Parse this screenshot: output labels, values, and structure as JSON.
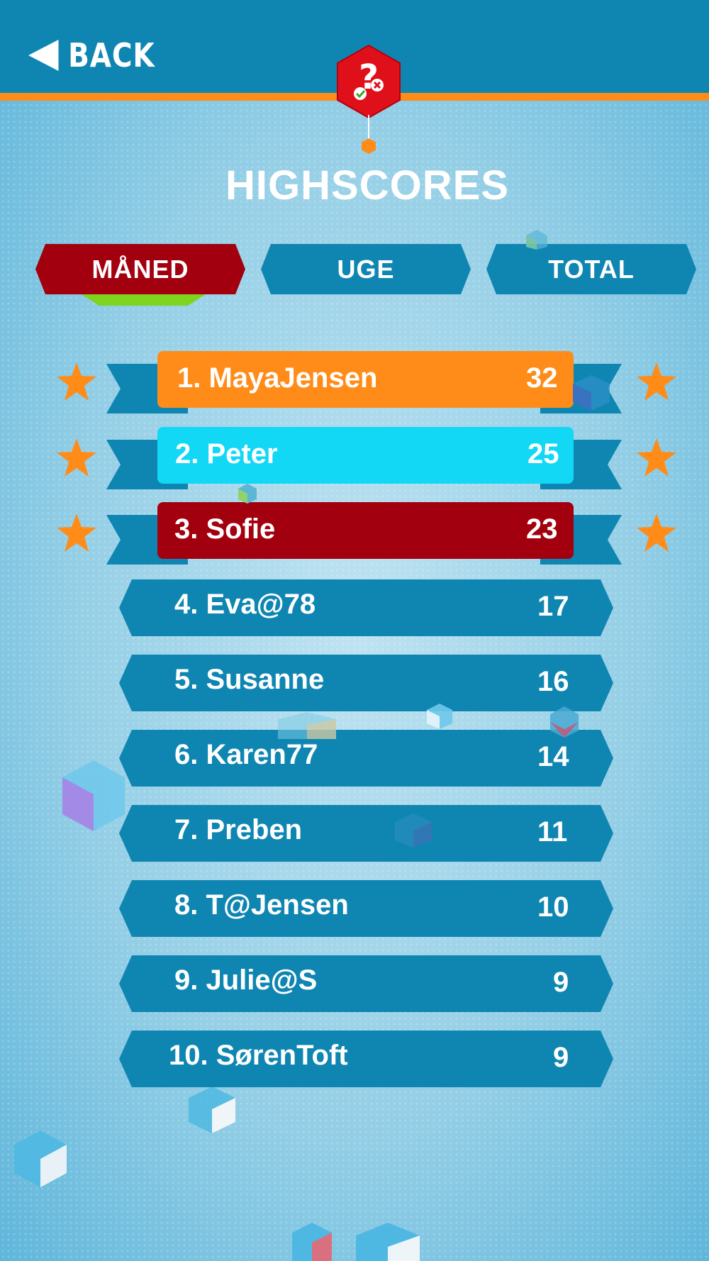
{
  "header": {
    "back_label": "BACK"
  },
  "page_title": "HIGHSCORES",
  "tabs": [
    {
      "label": "MÅNED",
      "active": true
    },
    {
      "label": "UGE",
      "active": false
    },
    {
      "label": "TOTAL",
      "active": false
    }
  ],
  "colors": {
    "header": "#0f86b2",
    "accent_stripe": "#ff8c19",
    "tab_active": "#a3000f",
    "tab_inactive": "#0f86b2",
    "tab_indicator": "#7fd420",
    "rank1": "#ff8c19",
    "rank2": "#12d8f5",
    "rank3": "#a3000f",
    "row_default": "#0f86b2",
    "star": "#ff8c19"
  },
  "leaderboard": [
    {
      "name": "1. MayaJensen",
      "score": "32"
    },
    {
      "name": "2. Peter",
      "score": "25"
    },
    {
      "name": "3. Sofie",
      "score": "23"
    },
    {
      "name": "4. Eva@78",
      "score": "17"
    },
    {
      "name": "5. Susanne",
      "score": "16"
    },
    {
      "name": "6. Karen77",
      "score": "14"
    },
    {
      "name": "7. Preben",
      "score": "11"
    },
    {
      "name": "8. T@Jensen",
      "score": "10"
    },
    {
      "name": "9. Julie@S",
      "score": "9"
    },
    {
      "name": "10. SørenToft",
      "score": "9"
    }
  ],
  "icons": [
    "back-arrow-icon",
    "quiz-badge-icon",
    "star-icon",
    "decorative-cube"
  ]
}
